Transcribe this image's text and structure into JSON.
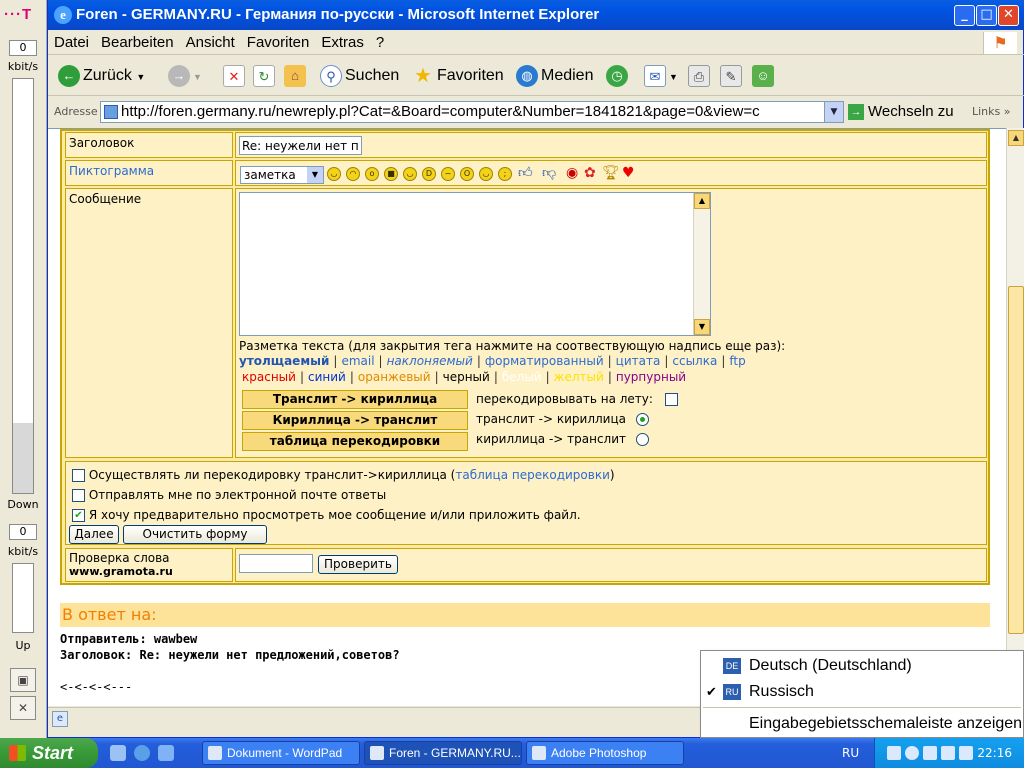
{
  "sidebar": {
    "logo": "···T",
    "down_value": "0",
    "down_unit": "kbit/s",
    "down_label": "Down",
    "up_value": "0",
    "up_unit": "kbit/s",
    "up_label": "Up"
  },
  "window": {
    "title": "Foren - GERMANY.RU - Германия по-русски - Microsoft Internet Explorer"
  },
  "menu": [
    "Datei",
    "Bearbeiten",
    "Ansicht",
    "Favoriten",
    "Extras",
    "?"
  ],
  "toolbar": {
    "back": "Zurück",
    "search": "Suchen",
    "favorites": "Favoriten",
    "media": "Medien"
  },
  "address": {
    "label": "Adresse",
    "url": "http://foren.germany.ru/newreply.pl?Cat=&Board=computer&Number=1841821&page=0&view=c",
    "go": "Wechseln zu",
    "links": "Links"
  },
  "form": {
    "subject_label": "Заголовок",
    "subject_value": "Re: неужели нет пре",
    "icon_label": "Пиктограмма",
    "icon_selected": "заметка",
    "message_label": "Сообщение",
    "markup_hint": "Разметка текста (для закрытия тега нажмите на соотвествующую надпись еще раз):",
    "tags_line1": [
      "утолщаемый",
      "email",
      "наклоняемый",
      "форматированный",
      "цитата",
      "ссылка",
      "ftp"
    ],
    "tags_line2": [
      "красный",
      "синий",
      "оранжевый",
      "черный",
      "белый",
      "желтый",
      "пурпурный"
    ],
    "tag_colors": [
      "#e00000",
      "#0033cc",
      "#e08a00",
      "#000000",
      "#ffffff",
      "#ffe000",
      "#8a008a"
    ],
    "translit_btn": "Транслит -> кириллица",
    "cyr_btn": "Кириллица -> транслит",
    "table_btn": "таблица перекодировки",
    "opt_live": "перекодировывать на лету:",
    "opt_to_cyr": "транслит -> кириллица",
    "opt_to_lat": "кириллица -> транслит",
    "cb1_text": "Осуществлять ли перекодировку транслит->кириллица (",
    "cb1_link": "таблица перекодировки",
    "cb1_end": ")",
    "cb2_text": "Отправлять мне по электронной почте ответы",
    "cb3_text": "Я хочу предварительно просмотреть мое сообщение и/или приложить файл.",
    "next_btn": "Далее",
    "clear_btn": "Очистить форму",
    "check_label": "Проверка слова",
    "check_site": "www.gramota.ru",
    "check_btn": "Проверить"
  },
  "reply": {
    "header": "В ответ на:",
    "sender": "Отправитель: wawbew",
    "subject": "Заголовок: Re: неужели нет предложений,советов?",
    "quote": "<-<-<-<---"
  },
  "lang_popup": {
    "items": [
      {
        "badge": "DE",
        "label": "Deutsch (Deutschland)"
      },
      {
        "badge": "RU",
        "label": "Russisch"
      }
    ],
    "show_bar": "Eingabegebietsschemaleiste anzeigen"
  },
  "taskbar": {
    "start": "Start",
    "tasks": [
      "Dokument - WordPad",
      "Foren - GERMANY.RU...",
      "Adobe Photoshop"
    ],
    "lang": "RU",
    "clock": "22:16"
  }
}
